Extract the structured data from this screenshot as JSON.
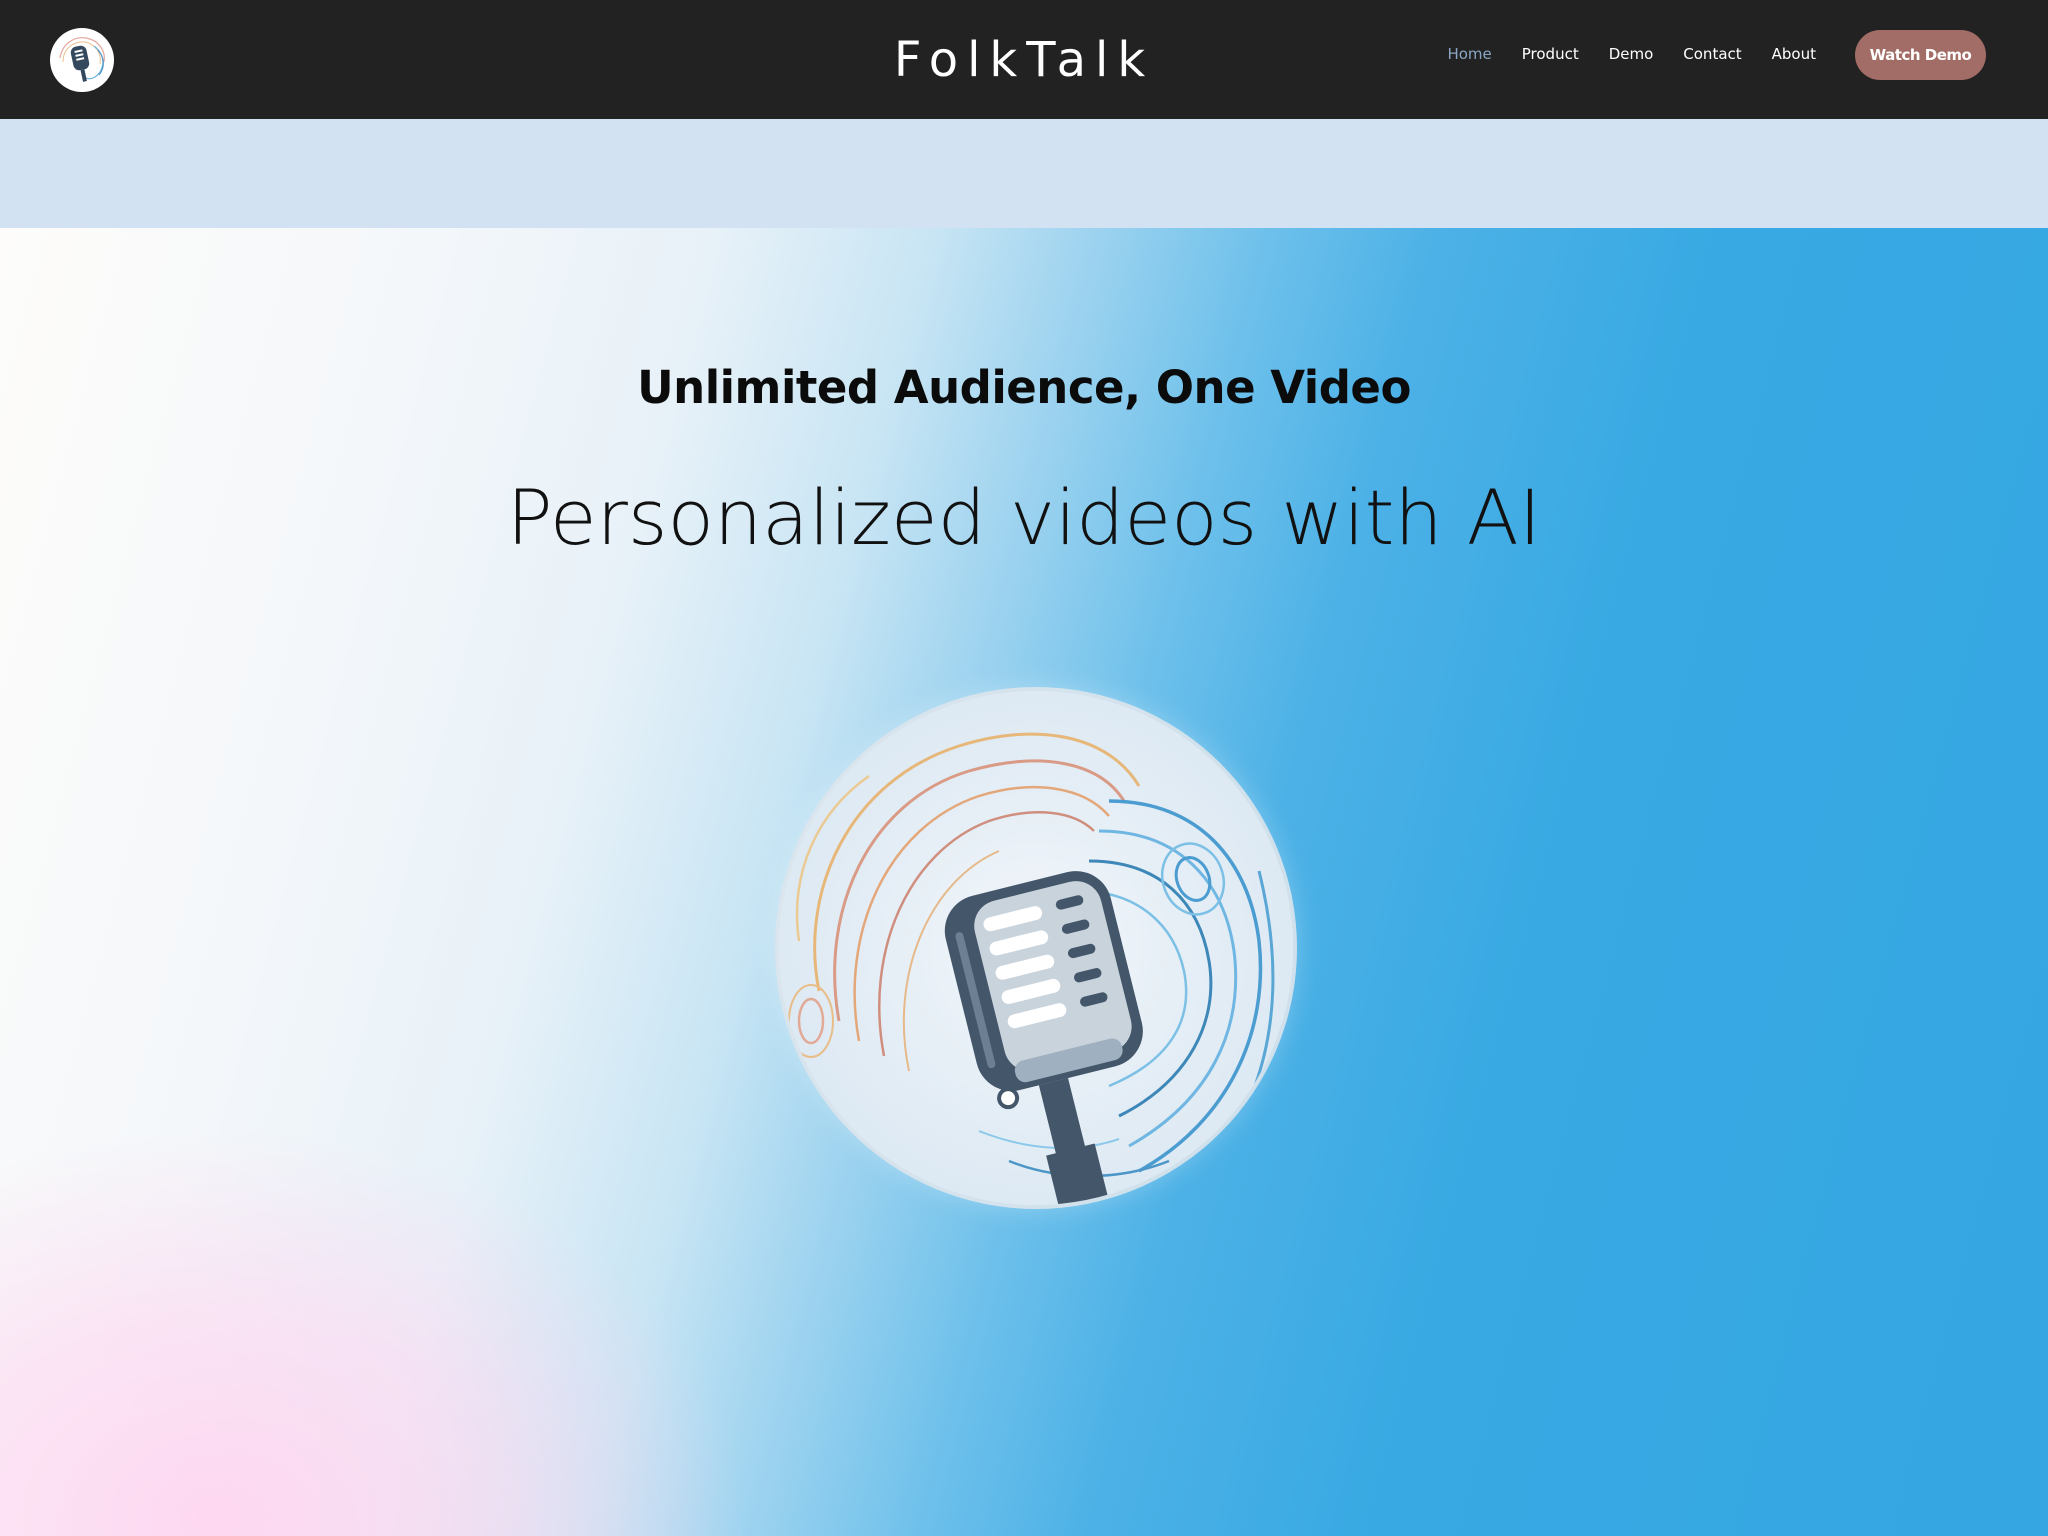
{
  "header": {
    "brand": "FolkTalk",
    "logo_icon": "microphone-logo-icon",
    "nav": [
      {
        "label": "Home",
        "active": true
      },
      {
        "label": "Product",
        "active": false
      },
      {
        "label": "Demo",
        "active": false
      },
      {
        "label": "Contact",
        "active": false
      },
      {
        "label": "About",
        "active": false
      }
    ],
    "cta_label": "Watch Demo"
  },
  "hero": {
    "subheading": "Unlimited Audience, One Video",
    "heading": "Personalized videos with AI",
    "image_icon": "microphone-icon"
  },
  "colors": {
    "topbar": "#222222",
    "band": "#d3e2f2",
    "cta": "#a26d66",
    "nav_active": "#8aa6c4",
    "hero_blue": "#35a6e2",
    "hero_pink": "#ffd6f0"
  }
}
